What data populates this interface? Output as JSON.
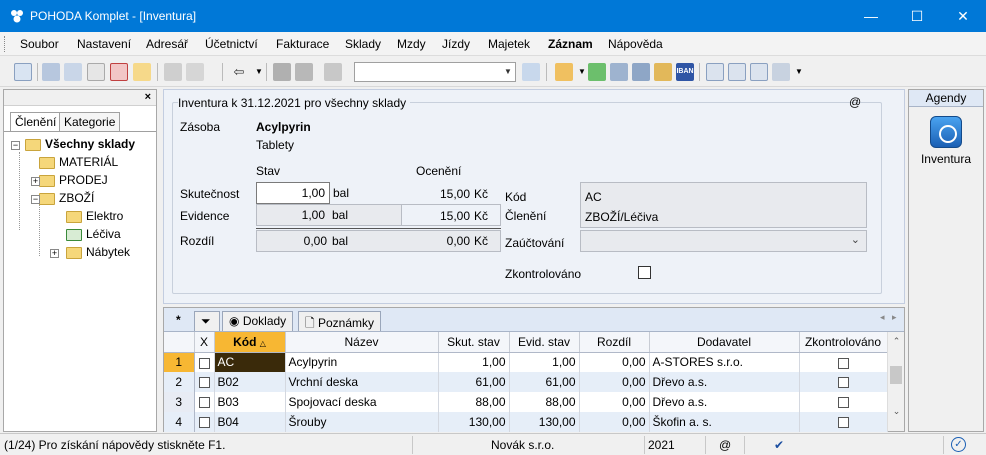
{
  "window": {
    "title": "POHODA Komplet - [Inventura]",
    "minimize": "—",
    "maximize": "☐",
    "close": "✕"
  },
  "menu": [
    "Soubor",
    "Nastavení",
    "Adresář",
    "Účetnictví",
    "Fakturace",
    "Sklady",
    "Mzdy",
    "Jízdy",
    "Majetek",
    "Záznam",
    "Nápověda"
  ],
  "toolbar": {
    "combo_value": "",
    "iban_label": "IBAN"
  },
  "left_panel": {
    "close": "×",
    "tabs": [
      "Členění",
      "Kategorie"
    ],
    "tree": {
      "root": "Všechny sklady",
      "items": [
        "MATERIÁL",
        "PRODEJ",
        "ZBOŽÍ",
        "Elektro",
        "Léčiva",
        "Nábytek"
      ]
    }
  },
  "form": {
    "section_title": "Inventura k 31.12.2021 pro všechny sklady",
    "at_symbol": "@",
    "zasoba_label": "Zásoba",
    "item_name": "Acylpyrin",
    "item_sub": "Tablety",
    "col_stav": "Stav",
    "col_oceneni": "Ocenění",
    "rows": [
      {
        "label": "Skutečnost",
        "qty": "1,00",
        "unit": "bal",
        "value": "15,00",
        "cur": "Kč"
      },
      {
        "label": "Evidence",
        "qty": "1,00",
        "unit": "bal",
        "value": "15,00",
        "cur": "Kč"
      },
      {
        "label": "Rozdíl",
        "qty": "0,00",
        "unit": "bal",
        "value": "0,00",
        "cur": "Kč"
      }
    ],
    "kod_label": "Kód",
    "kod_value": "AC",
    "cleneni_label": "Členění",
    "cleneni_value": "ZBOŽÍ/Léčiva",
    "zauctovani_label": "Zaúčtování",
    "zauctovani_value": "",
    "zkontrolovano_label": "Zkontrolováno"
  },
  "grid": {
    "tabs": {
      "star": "*",
      "doklady": "Doklady",
      "poznamky": "Poznámky"
    },
    "columns": [
      "X",
      "Kód",
      "Název",
      "Skut. stav",
      "Evid. stav",
      "Rozdíl",
      "Dodavatel",
      "Zkontrolováno"
    ],
    "rows": [
      {
        "n": "1",
        "kod": "AC",
        "nazev": "Acylpyrin",
        "skut": "1,00",
        "evid": "1,00",
        "rozdil": "0,00",
        "dodavatel": "A-STORES s.r.o."
      },
      {
        "n": "2",
        "kod": "B02",
        "nazev": "Vrchní deska",
        "skut": "61,00",
        "evid": "61,00",
        "rozdil": "0,00",
        "dodavatel": "Dřevo a.s."
      },
      {
        "n": "3",
        "kod": "B03",
        "nazev": "Spojovací deska",
        "skut": "88,00",
        "evid": "88,00",
        "rozdil": "0,00",
        "dodavatel": "Dřevo a.s."
      },
      {
        "n": "4",
        "kod": "B04",
        "nazev": "Šrouby",
        "skut": "130,00",
        "evid": "130,00",
        "rozdil": "0,00",
        "dodavatel": "Škofin a. s."
      }
    ]
  },
  "agenda": {
    "header": "Agendy",
    "item": "Inventura"
  },
  "status": {
    "hint": "(1/24) Pro získání nápovědy stiskněte F1.",
    "company": "Novák s.r.o.",
    "year": "2021",
    "at": "@"
  }
}
